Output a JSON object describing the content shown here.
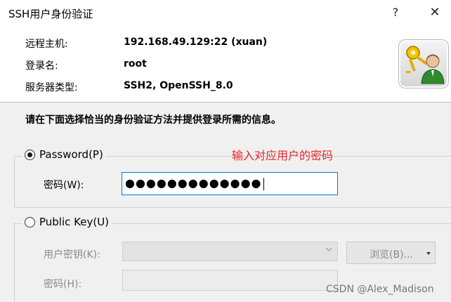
{
  "window": {
    "title": "SSH用户身份验证",
    "help_glyph": "?",
    "close_glyph": "✕"
  },
  "connection": {
    "host_label": "远程主机:",
    "host_value": "192.168.49.129:22 (xuan)",
    "login_label": "登录名:",
    "login_value": "root",
    "server_type_label": "服务器类型:",
    "server_type_value": "SSH2, OpenSSH_8.0"
  },
  "instruction": "请在下面选择恰当的身份验证方法并提供登录所需的信息。",
  "password_group": {
    "radio_label": "Password(P)",
    "selected": true,
    "password_label": "密码(W):",
    "password_value": "●●●●●●●●●●●●●"
  },
  "annotation": "输入对应用户的密码",
  "publickey_group": {
    "radio_label": "Public Key(U)",
    "selected": false,
    "user_key_label": "用户密钥(K):",
    "browse_label": "浏览(B)...",
    "passphrase_label": "密码(H):"
  },
  "watermark": "CSDN @Alex_Madison",
  "icons": {
    "logo": "keys-user-icon",
    "dropdown": "chevron-down-icon"
  },
  "colors": {
    "input_focus_border": "#0078d7",
    "annotation": "#e8262f"
  }
}
